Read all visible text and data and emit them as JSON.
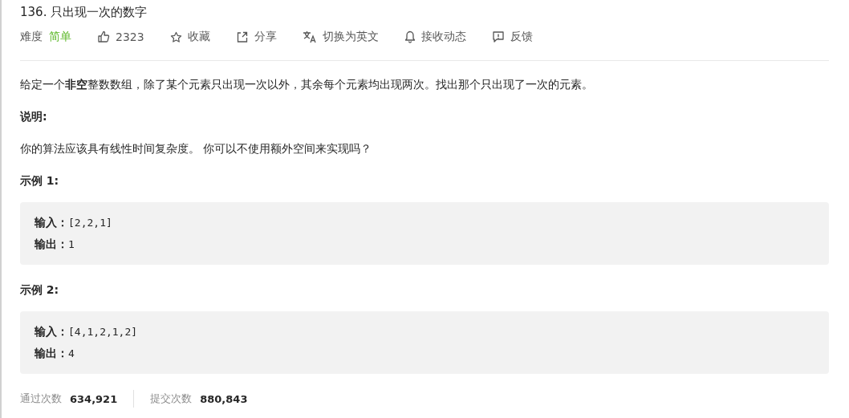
{
  "title": "136. 只出现一次的数字",
  "meta": {
    "difficulty_label": "难度",
    "difficulty": "简单",
    "actions": [
      {
        "kind": "like",
        "label": "2323"
      },
      {
        "kind": "star",
        "label": "收藏"
      },
      {
        "kind": "share",
        "label": "分享"
      },
      {
        "kind": "translate",
        "label": "切换为英文"
      },
      {
        "kind": "bell",
        "label": "接收动态"
      },
      {
        "kind": "feedback",
        "label": "反馈"
      }
    ]
  },
  "content": [
    {
      "kind": "para",
      "text": "给定一个**非空**整数数组，除了某个元素只出现一次以外，其余每个元素均出现两次。找出那个只出现了一次的元素。"
    },
    {
      "kind": "heading",
      "text": "说明:"
    },
    {
      "kind": "para",
      "text": "你的算法应该具有线性时间复杂度。 你可以不使用额外空间来实现吗？"
    },
    {
      "kind": "heading",
      "text": "示例 1:"
    },
    {
      "kind": "example",
      "lines": [
        {
          "label": "输入：",
          "value": "[2,2,1]"
        },
        {
          "label": "输出：",
          "value": "1"
        }
      ]
    },
    {
      "kind": "heading",
      "text": "示例 2:"
    },
    {
      "kind": "example",
      "lines": [
        {
          "label": "输入：",
          "value": "[4,1,2,1,2]"
        },
        {
          "label": "输出：",
          "value": "4"
        }
      ]
    }
  ],
  "stats": [
    {
      "label": "通过次数",
      "value": "634,921"
    },
    {
      "label": "提交次数",
      "value": "880,843"
    }
  ]
}
